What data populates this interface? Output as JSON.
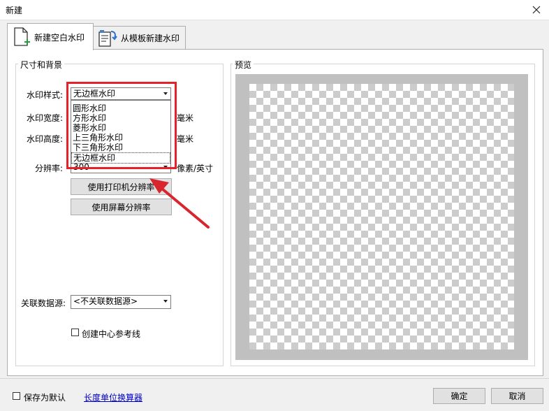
{
  "window": {
    "title": "新建"
  },
  "tabs": [
    {
      "label": "新建空白水印",
      "icon": "new-blank-document-icon"
    },
    {
      "label": "从模板新建水印",
      "icon": "template-document-icon"
    }
  ],
  "size_group": {
    "title": "尺寸和背景",
    "style_label": "水印样式:",
    "style_value": "无边框水印",
    "style_options": [
      "圆形水印",
      "方形水印",
      "菱形水印",
      "上三角形水印",
      "下三角形水印",
      "无边框水印"
    ],
    "width_label": "水印宽度:",
    "height_label": "水印高度:",
    "unit_mm": "毫米",
    "resolution_label": "分辨率:",
    "resolution_value": "300",
    "resolution_unit": "像素/英寸",
    "printer_res_button": "使用打印机分辨率",
    "screen_res_button": "使用屏幕分辨率",
    "datasource_label": "关联数据源:",
    "datasource_value": "<不关联数据源>",
    "center_guide_label": "创建中心参考线"
  },
  "preview_group": {
    "title": "预览"
  },
  "footer": {
    "save_default_label": "保存为默认",
    "unit_converter_link": "长度单位换算器",
    "ok_button": "确定",
    "cancel_button": "取消"
  },
  "colors": {
    "highlight": "#e8202a",
    "preview_frame": "#c0c0c0"
  }
}
